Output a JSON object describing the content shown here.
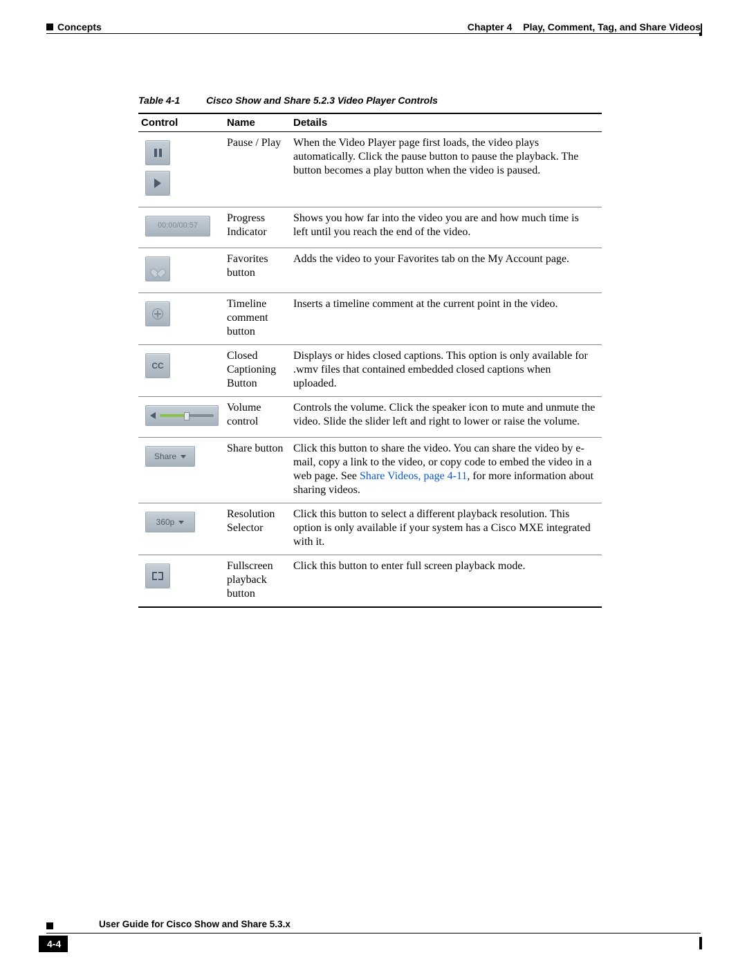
{
  "header": {
    "section": "Concepts",
    "chapter_label": "Chapter 4",
    "chapter_title": "Play, Comment, Tag, and Share Videos"
  },
  "table": {
    "number": "Table 4-1",
    "title": "Cisco Show and Share 5.2.3 Video Player Controls",
    "columns": {
      "c1": "Control",
      "c2": "Name",
      "c3": "Details"
    },
    "rows": [
      {
        "icon": "pause",
        "icon2": "play",
        "name": "Pause / Play",
        "details": "When the Video Player page first loads, the video plays automatically. Click the pause button to pause the playback. The button becomes a play button when the video is paused."
      },
      {
        "icon": "progress",
        "icon_text": "00:00/00:57",
        "name": "Progress Indicator",
        "details": "Shows you how far into the video you are and how much time is left until you reach the end of the video."
      },
      {
        "icon": "favorite",
        "name": "Favorites button",
        "details": "Adds the video to your Favorites tab on the My Account page."
      },
      {
        "icon": "timeline-comment",
        "name": "Timeline comment button",
        "details": "Inserts a timeline comment at the current point in the video."
      },
      {
        "icon": "cc",
        "icon_text": "CC",
        "name": "Closed Captioning Button",
        "details": "Displays or hides closed captions. This option is only available for .wmv files that contained embedded closed captions when uploaded."
      },
      {
        "icon": "volume",
        "name": "Volume control",
        "details": "Controls the volume. Click the speaker icon to mute and unmute the video. Slide the slider left and right to lower or raise the volume."
      },
      {
        "icon": "share",
        "icon_text": "Share",
        "name": "Share button",
        "details_pre": "Click this button to share the video. You can share the video by e-mail, copy a link to the video, or copy code to embed the video in a web page. See ",
        "link_text": "Share Videos, page 4-11",
        "details_post": ", for more information about sharing videos."
      },
      {
        "icon": "resolution",
        "icon_text": "360p",
        "name": "Resolution Selector",
        "details": "Click this button to select a different playback resolution. This option is only available if your system has a Cisco MXE integrated with it."
      },
      {
        "icon": "fullscreen",
        "name": "Fullscreen playback button",
        "details": "Click this button to enter full screen playback mode."
      }
    ]
  },
  "footer": {
    "guide_title": "User Guide for Cisco Show and Share 5.3.x",
    "page_number": "4-4"
  }
}
